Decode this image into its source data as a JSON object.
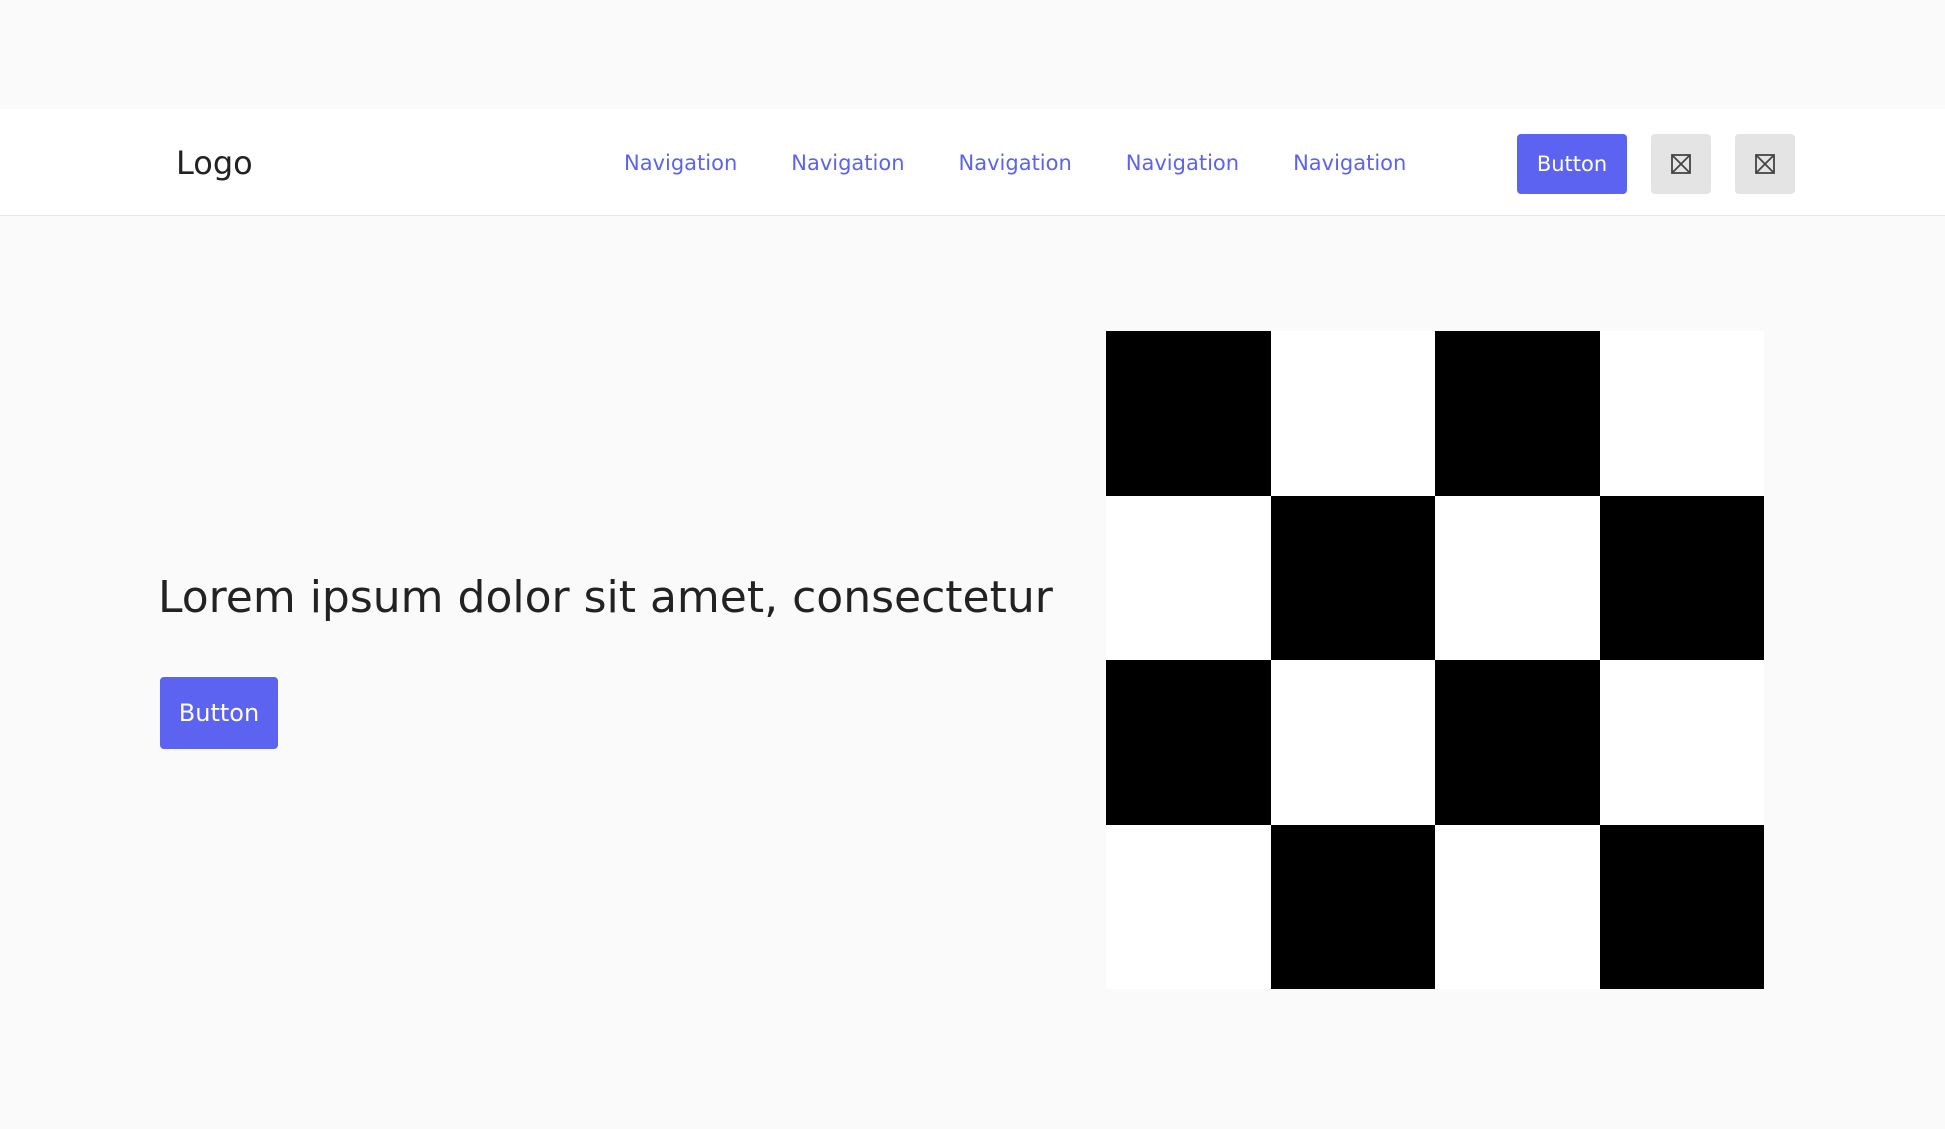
{
  "header": {
    "logo": "Logo",
    "nav": [
      "Navigation",
      "Navigation",
      "Navigation",
      "Navigation",
      "Navigation"
    ],
    "button_label": "Button",
    "icon_buttons": [
      "image-placeholder-icon",
      "image-placeholder-icon"
    ]
  },
  "hero": {
    "headline": "Lorem ipsum dolor sit amet, consectetur",
    "button_label": "Button",
    "image": "checkerboard-image"
  },
  "colors": {
    "accent": "#5b63f0",
    "background": "#fafafa",
    "header_bg": "#ffffff",
    "icon_button_bg": "#e4e4e4"
  }
}
